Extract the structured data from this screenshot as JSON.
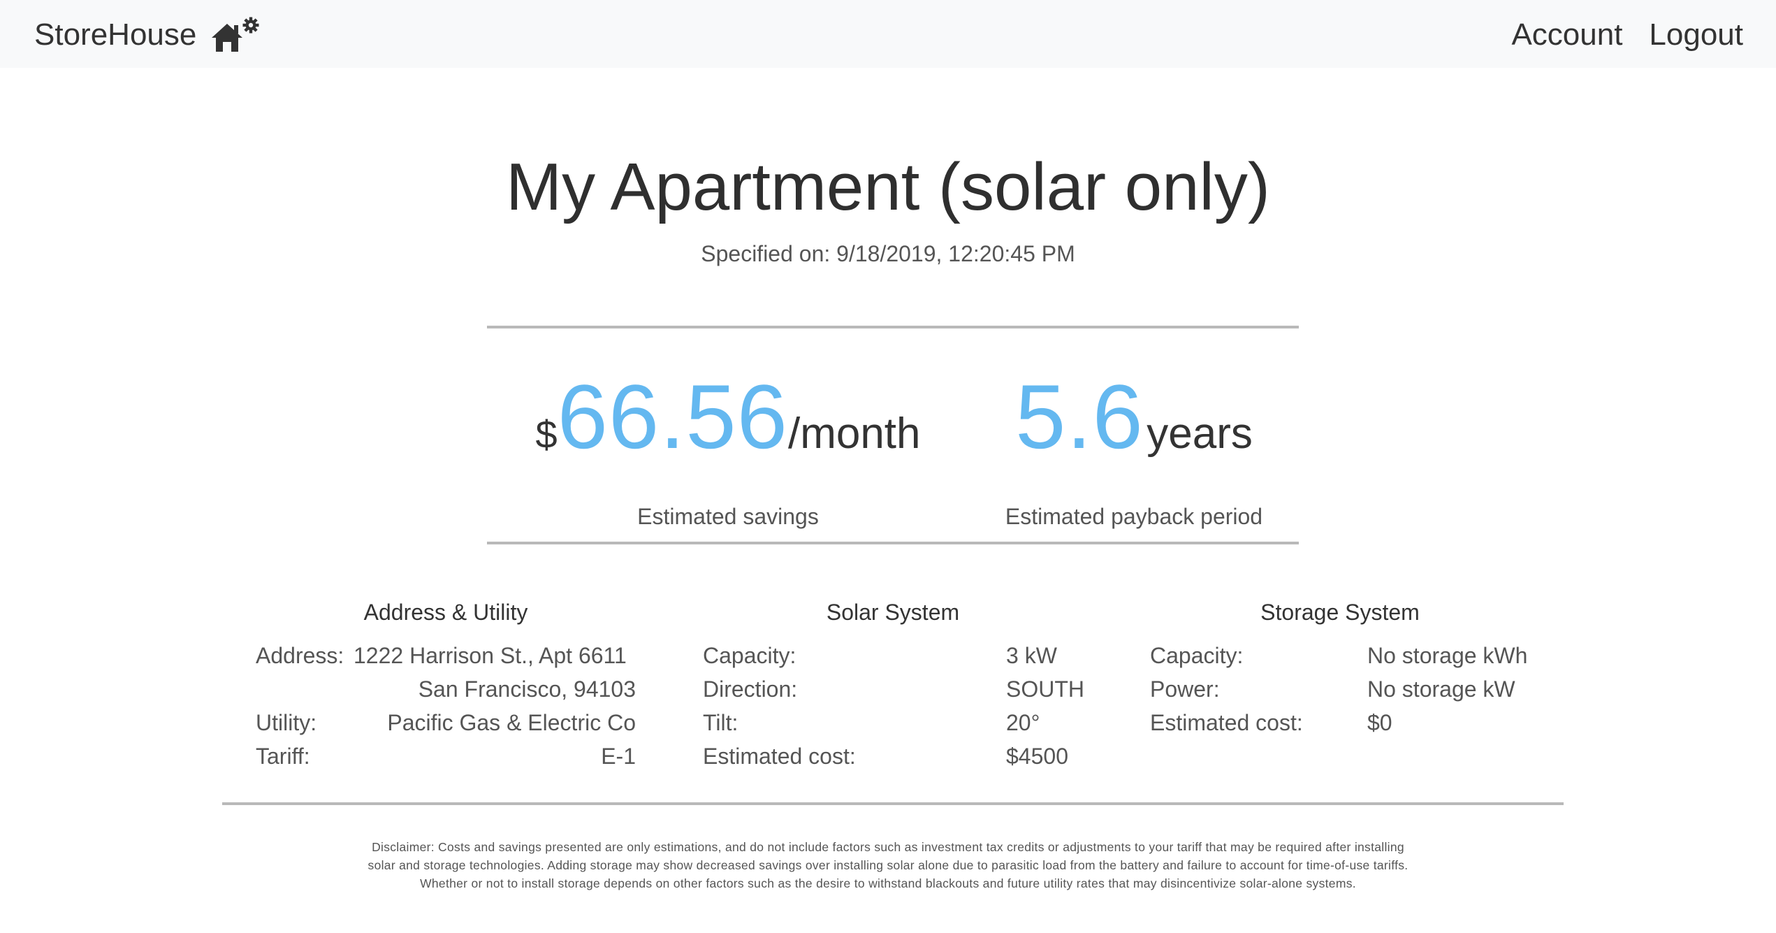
{
  "navbar": {
    "brand": "StoreHouse",
    "brand_icon": "house-gear-icon",
    "links": [
      "Account",
      "Logout"
    ]
  },
  "header": {
    "title": "My Apartment (solar only)",
    "specified": "Specified on: 9/18/2019, 12:20:45 PM"
  },
  "stats": {
    "savings": {
      "currency": "$",
      "value": "66.56",
      "unit": "/month",
      "caption": "Estimated savings"
    },
    "payback": {
      "value": "5.6",
      "unit": "years",
      "caption": "Estimated payback period"
    }
  },
  "address_utility": {
    "title": "Address & Utility",
    "address_label": "Address:",
    "address_line1": "1222 Harrison St., Apt 6611",
    "address_line2": "San Francisco, 94103",
    "utility_label": "Utility:",
    "utility_value": "Pacific Gas & Electric Co",
    "tariff_label": "Tariff:",
    "tariff_value": "E-1"
  },
  "solar_system": {
    "title": "Solar System",
    "rows": [
      {
        "label": "Capacity:",
        "value": "3 kW"
      },
      {
        "label": "Direction:",
        "value": "SOUTH"
      },
      {
        "label": "Tilt:",
        "value": "20°"
      },
      {
        "label": "Estimated cost:",
        "value": "$4500"
      }
    ]
  },
  "storage_system": {
    "title": "Storage System",
    "rows": [
      {
        "label": "Capacity:",
        "value": "No storage kWh"
      },
      {
        "label": "Power:",
        "value": "No storage kW"
      },
      {
        "label": "Estimated cost:",
        "value": "$0"
      }
    ]
  },
  "disclaimer": "Disclaimer: Costs and savings presented are only estimations, and do not include factors such as investment tax credits or adjustments to your tariff that may be required after installing solar and storage technologies. Adding storage may show decreased savings over installing solar alone due to parasitic load from the battery and failure to account for time-of-use tariffs. Whether or not to install storage depends on other factors such as the desire to withstand blackouts and future utility rates that may disincentivize solar-alone systems.",
  "colors": {
    "accent": "#64b8f0",
    "navbar_bg": "#f8f9fa",
    "rule": "#b9b9b9",
    "text": "#333333"
  }
}
